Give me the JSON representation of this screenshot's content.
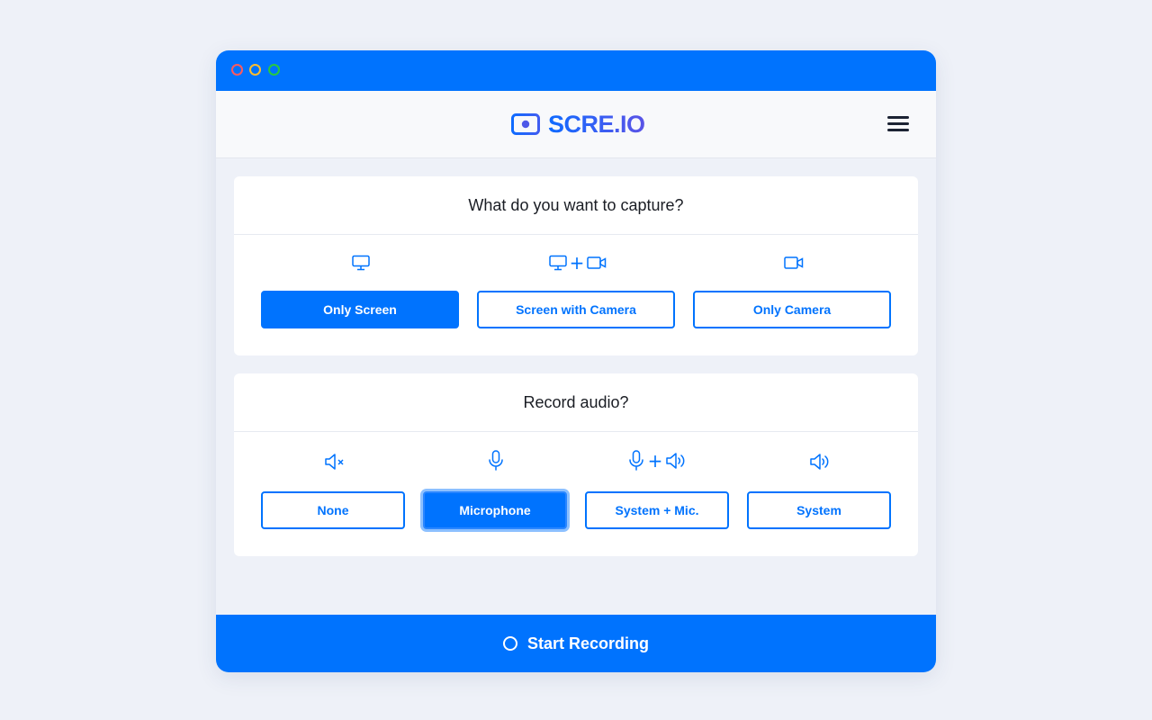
{
  "app": {
    "brand_name": "SCRE.IO",
    "brand_gradient": [
      "#0f6bff",
      "#5a53e6"
    ],
    "accent_color": "#0073fe",
    "window_dots": [
      "red",
      "yellow",
      "green"
    ]
  },
  "capture": {
    "title": "What do you want to capture?",
    "options": [
      {
        "label": "Only Screen",
        "icons": [
          "monitor-icon"
        ],
        "selected": true
      },
      {
        "label": "Screen with Camera",
        "icons": [
          "monitor-icon",
          "plus",
          "camera-icon"
        ],
        "selected": false
      },
      {
        "label": "Only Camera",
        "icons": [
          "camera-icon"
        ],
        "selected": false
      }
    ]
  },
  "audio": {
    "title": "Record audio?",
    "plus_symbol": "+",
    "options": [
      {
        "label": "None",
        "icons": [
          "speaker-muted-icon"
        ],
        "selected": false
      },
      {
        "label": "Microphone",
        "icons": [
          "microphone-icon"
        ],
        "selected": true
      },
      {
        "label": "System + Mic.",
        "icons": [
          "microphone-icon",
          "plus",
          "speaker-icon"
        ],
        "selected": false
      },
      {
        "label": "System",
        "icons": [
          "speaker-icon"
        ],
        "selected": false
      }
    ]
  },
  "footer": {
    "start_label": "Start Recording",
    "icon": "record-circle-icon"
  }
}
